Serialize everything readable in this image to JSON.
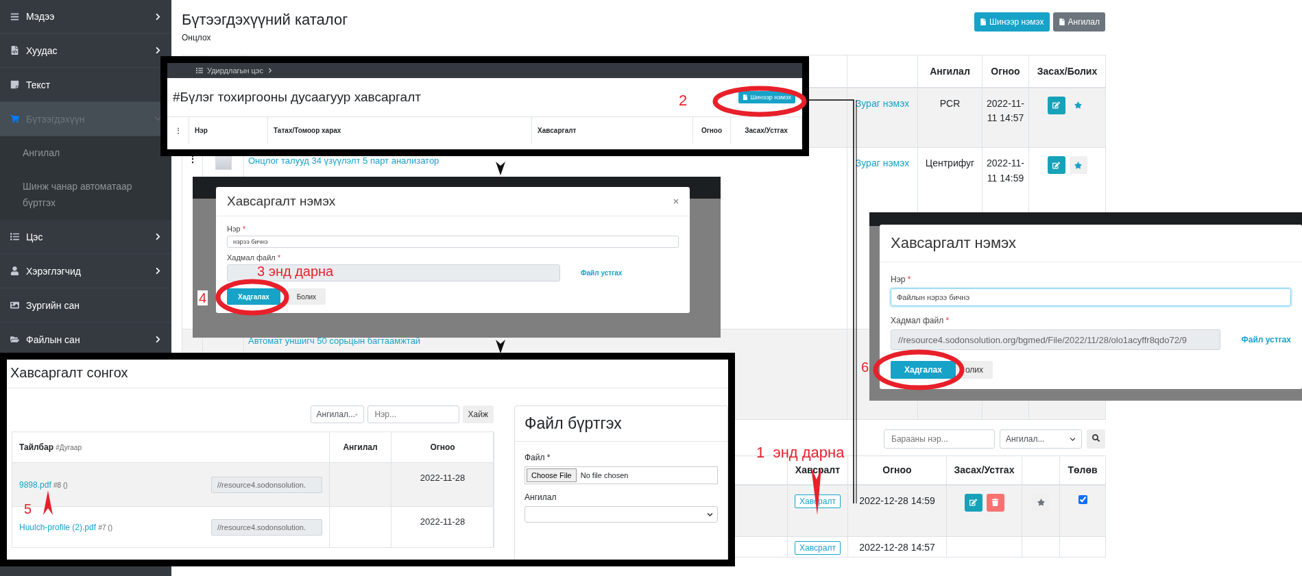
{
  "sidebar": {
    "items": [
      {
        "label": "Мэдээ",
        "selected": false,
        "has_submenu": true,
        "expanded": false
      },
      {
        "label": "Хуудас",
        "selected": false,
        "has_submenu": true,
        "expanded": false
      },
      {
        "label": "Текст",
        "selected": false,
        "has_submenu": false
      },
      {
        "label": "Бүтээгдэхүүн",
        "selected": true,
        "has_submenu": true,
        "expanded": true,
        "children": [
          {
            "label": "Ангилал"
          },
          {
            "label": "Шинж чанар автоматаар бүртгэх"
          }
        ]
      },
      {
        "label": "Цэс",
        "selected": false,
        "has_submenu": true,
        "expanded": false
      },
      {
        "label": "Хэрэглэгчид",
        "selected": false,
        "has_submenu": true,
        "expanded": false
      },
      {
        "label": "Зургийн сан",
        "selected": false,
        "has_submenu": false
      },
      {
        "label": "Файлын сан",
        "selected": false,
        "has_submenu": true,
        "expanded": false
      }
    ]
  },
  "page": {
    "title": "Бүтээгдэхүүний каталог",
    "subtitle": "Онцлох",
    "buttons": [
      {
        "label": "Шинээр нэмэх",
        "kind": "primary"
      },
      {
        "label": "Ангилал",
        "kind": "secondary"
      }
    ]
  },
  "catalog_table": {
    "columns": [
      "Ангилал",
      "Огноо",
      "Засах/Болих"
    ],
    "rows": [
      {
        "link": "Зураг нэмэх",
        "category": "PCR",
        "date": "2022-11-11 14:57",
        "starred": true
      },
      {
        "menu": "⋮",
        "title": "Онцлог талууд 34 үзүүлэлт 5 парт анализатор",
        "link": "Зураг нэмэх",
        "category": "Центрифуг",
        "date": "2022-11-11 14:59",
        "starred": true
      },
      {
        "title": "Автомат уншигч 50 сорьцын багтаамжтай"
      }
    ]
  },
  "attachments_table": {
    "search_placeholder": "Барааны нэр...",
    "category_filter": "Ангилал...",
    "columns": [
      "Хавсралт",
      "Огноо",
      "Засах/Устгах",
      "Төлөв"
    ],
    "rows": [
      {
        "attachment": "Хавсралт",
        "date": "2022-12-28 14:59",
        "active": true
      },
      {
        "attachment": "Хавсралт",
        "date": "2022-12-28 14:57"
      }
    ]
  },
  "step_screens": [
    {
      "kind": "group_page",
      "menu": "Удирдлагын цэс",
      "column_menu": "⋮",
      "title": "#Бүлэг тохиргооны дусаагуур хавсаргалт",
      "button": "Шинээр нэмэх",
      "columns": [
        "Нэр",
        "Татах/Томоор харах",
        "Хавсаргалт",
        "Огноо",
        "Засах/Устгах"
      ]
    },
    {
      "kind": "attach_modal",
      "title": "Хавсаргалт нэмэх",
      "name_label": "Нэр",
      "required_mark": "*",
      "name_value": "нэрээ бичнэ",
      "focused": false,
      "file_label": "Хадмал файл",
      "remove_link": "Файл устгах",
      "save": "Хадгалах",
      "cancel": "Болих"
    },
    {
      "kind": "attach_modal",
      "title": "Хавсаргалт нэмэх",
      "name_label": "Нэр",
      "required_mark": "*",
      "name_value": "Файлын нэрээ бичнэ",
      "focused": true,
      "file_label": "Хадмал файл",
      "file_value": "//resource4.sodonsolution.org/bgmed/File/2022/11/28/olo1acyffr8qdo72/9",
      "remove_link": "Файл устгах",
      "save": "Хадгалах",
      "cancel": "олих"
    },
    {
      "kind": "file_picker",
      "title": "Хавсаргалт сонгох",
      "category_filter": "Ангилал...",
      "name_placeholder": "Нэр...",
      "search_button": "Хайж",
      "columns": [
        "Тайлбар",
        "Ангилал",
        "Огноо"
      ],
      "column_note": "#Дугаар",
      "rows": [
        {
          "name": "9898.pdf",
          "number": "#8",
          "extra": "()",
          "path": "//resource4.sodonsolution.",
          "date": "2022-11-28"
        },
        {
          "name": "Huulch-profile (2).pdf",
          "number": "#7",
          "extra": "()",
          "path": "//resource4.sodonsolution.",
          "date": "2022-11-28"
        }
      ],
      "upload": {
        "title": "Файл бүртгэх",
        "file_label": "Файл *",
        "choose_button": "Choose File",
        "no_file": "No file chosen",
        "category_label": "Ангилал"
      }
    }
  ],
  "callouts": [
    {
      "text": "2"
    },
    {
      "text": "3 энд дарна"
    },
    {
      "text": "4"
    },
    {
      "text": "5"
    },
    {
      "text": "6"
    },
    {
      "text": "1  энд дарна"
    }
  ]
}
